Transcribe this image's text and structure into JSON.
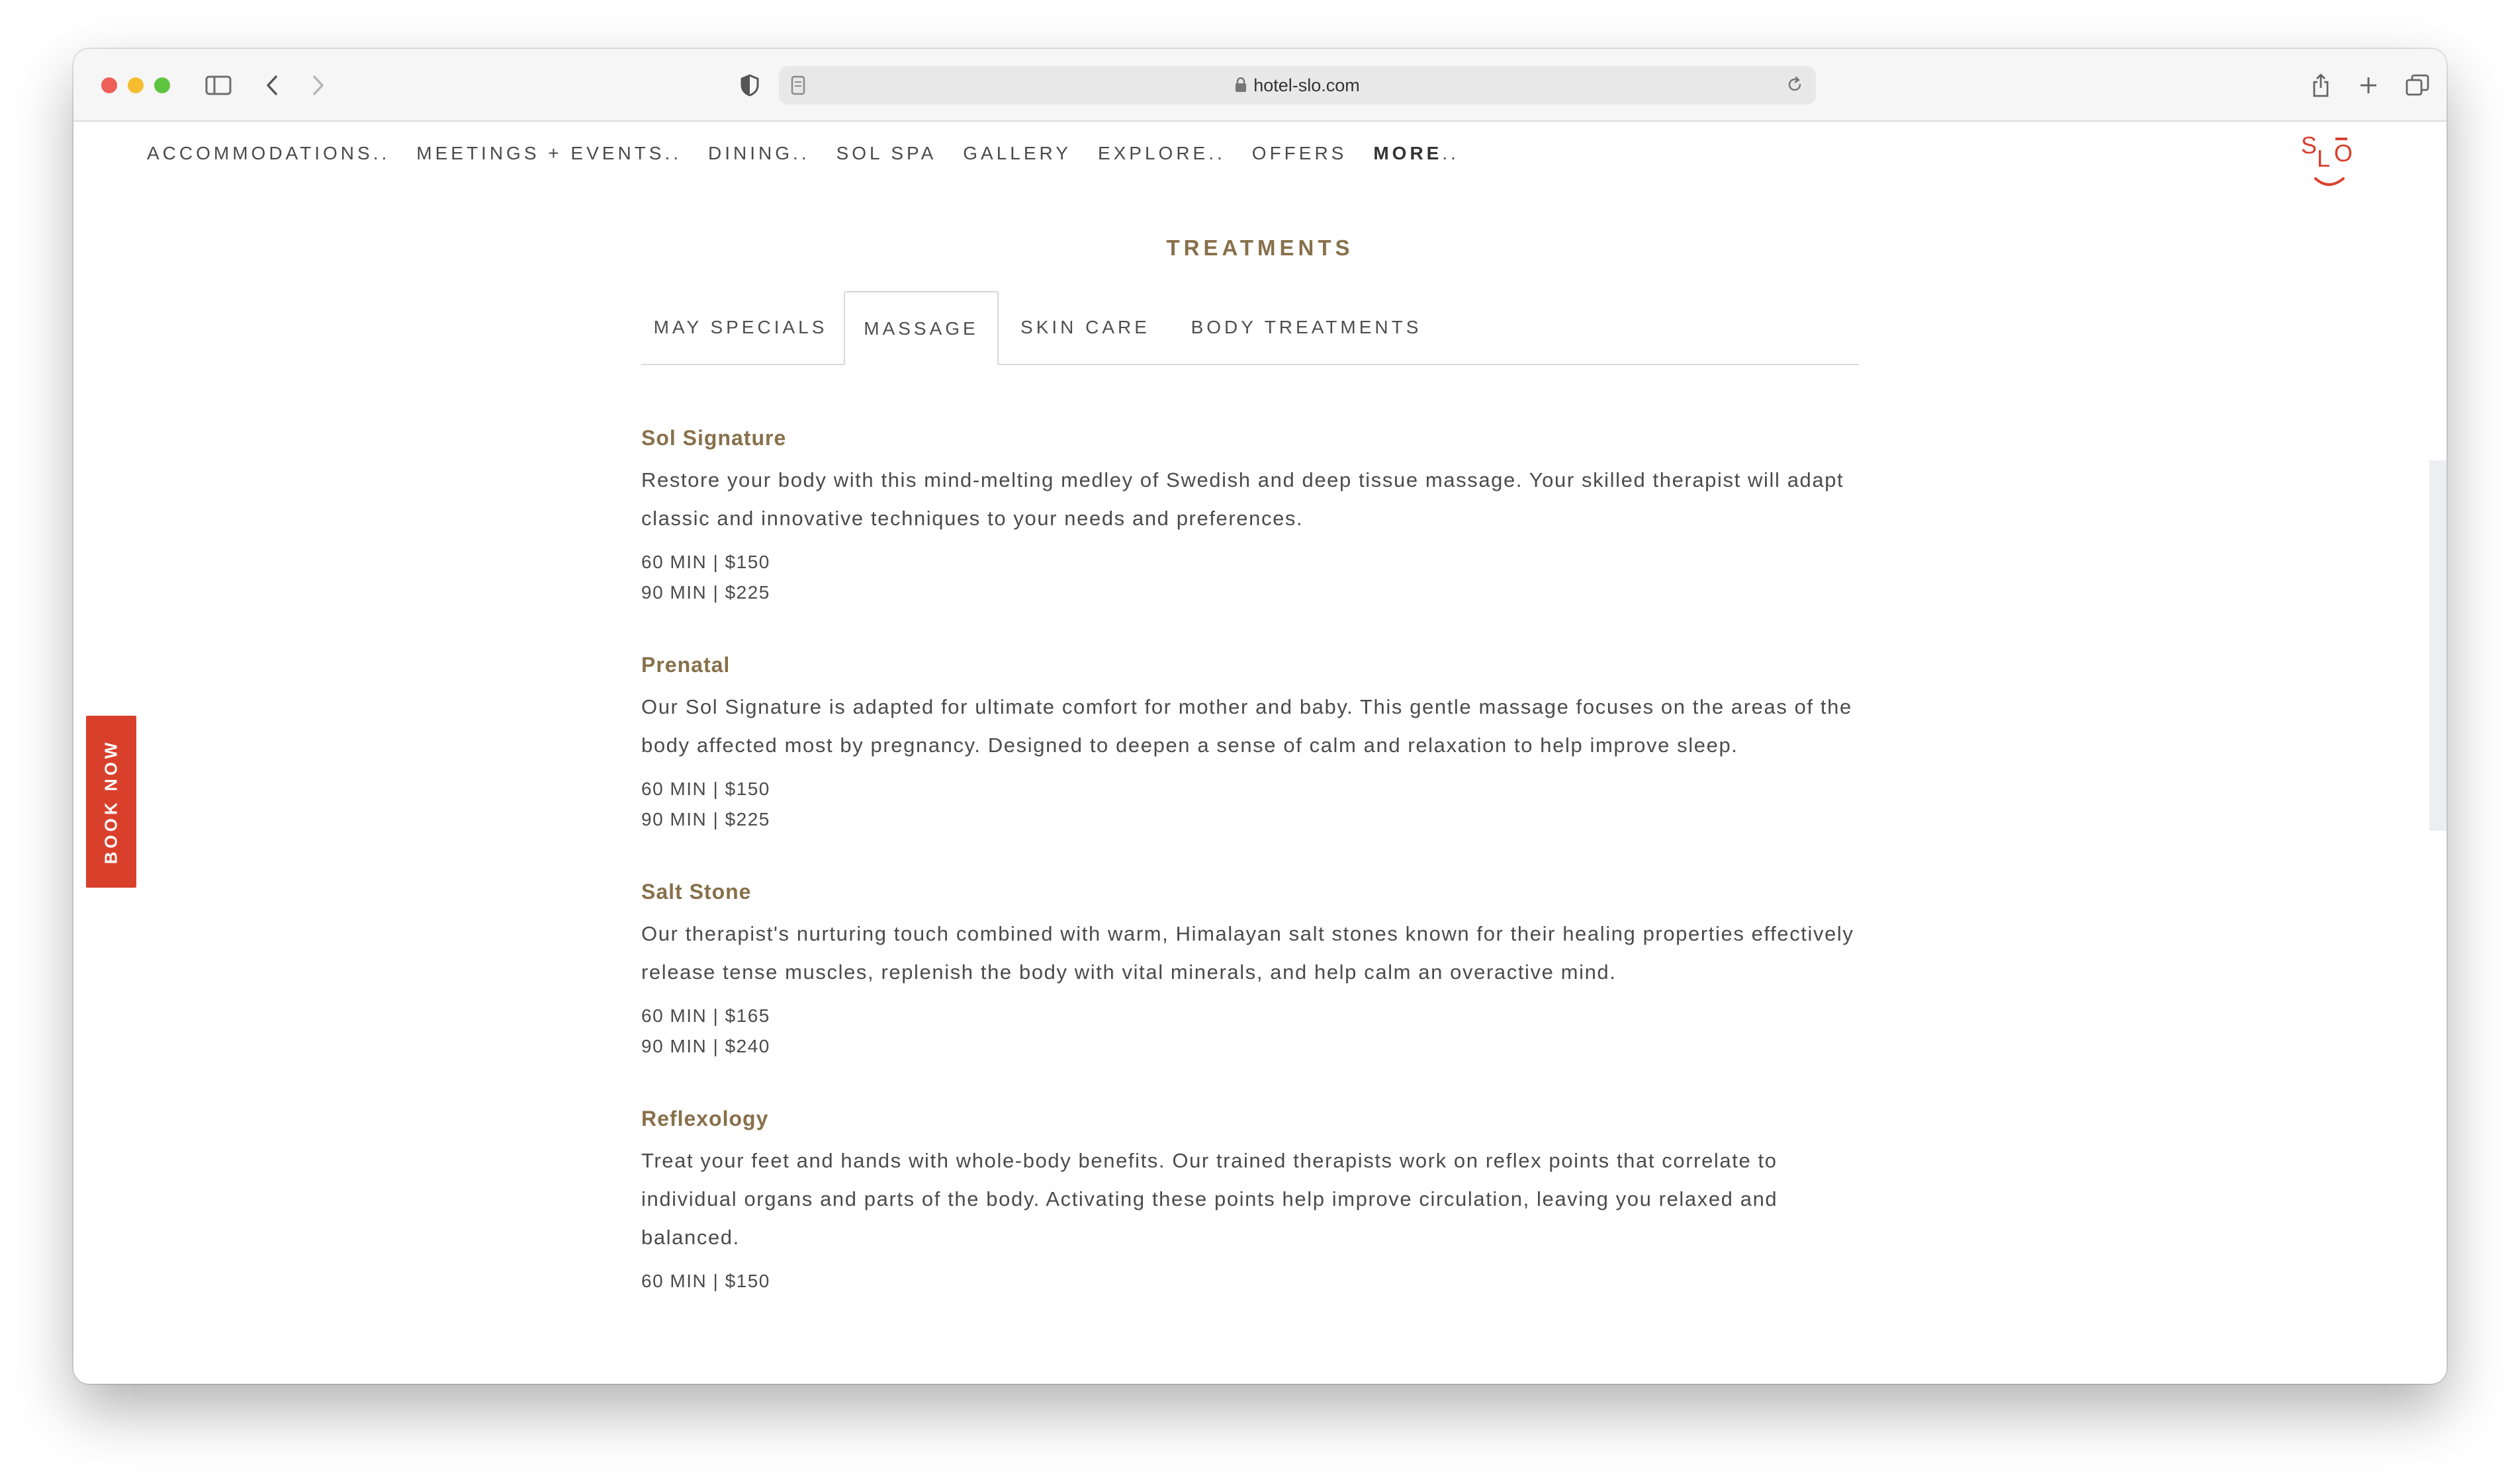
{
  "browser": {
    "url": "hotel-slo.com"
  },
  "nav": {
    "items": [
      "ACCOMMODATIONS..",
      "MEETINGS + EVENTS..",
      "DINING..",
      "SOL SPA",
      "GALLERY",
      "EXPLORE..",
      "OFFERS"
    ],
    "more": "MORE",
    "more_suffix": ".."
  },
  "logo": {
    "text": "SLO"
  },
  "section_title": "TREATMENTS",
  "tabs": [
    {
      "label": "MAY SPECIALS",
      "active": false
    },
    {
      "label": "MASSAGE",
      "active": true
    },
    {
      "label": "SKIN CARE",
      "active": false
    },
    {
      "label": "BODY TREATMENTS",
      "active": false
    }
  ],
  "treatments": [
    {
      "name": "Sol Signature",
      "description": "Restore your body with this mind-melting medley of Swedish and deep tissue massage. Your skilled therapist will adapt classic and innovative techniques to your needs and preferences.",
      "prices": [
        "60 MIN | $150",
        "90 MIN | $225"
      ]
    },
    {
      "name": "Prenatal",
      "description": "Our Sol Signature is adapted for ultimate comfort for mother and baby. This gentle massage focuses on the areas of the body affected most by pregnancy. Designed to deepen a sense of calm and relaxation to help improve sleep.",
      "prices": [
        "60 MIN | $150",
        "90 MIN | $225"
      ]
    },
    {
      "name": "Salt Stone",
      "description": "Our therapist's nurturing touch combined with warm, Himalayan salt stones known for their healing properties effectively release tense muscles, replenish the body with vital minerals, and help calm an overactive mind.",
      "prices": [
        "60 MIN | $165",
        "90 MIN | $240"
      ]
    },
    {
      "name": "Reflexology",
      "description": "Treat your feet and hands with whole-body benefits. Our trained therapists work on reflex points that correlate to individual organs and parts of the body. Activating these points help improve circulation, leaving you relaxed and balanced.",
      "prices": [
        "60 MIN | $150"
      ]
    }
  ],
  "book_now": "BOOK NOW",
  "colors": {
    "accent_gold": "#87704a",
    "brand_red": "#d9402c"
  }
}
